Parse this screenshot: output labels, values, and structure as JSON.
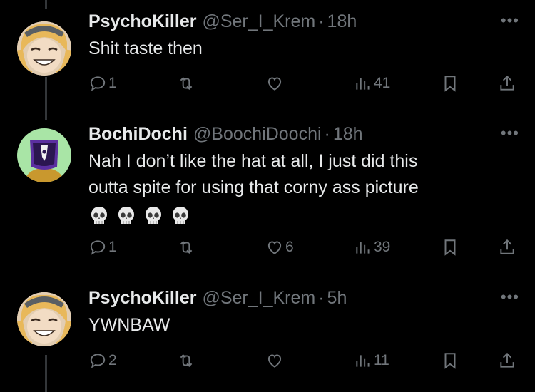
{
  "tweets": [
    {
      "name": "PsychoKiller",
      "handle": "@Ser_I_Krem",
      "time": "18h",
      "text_lines": [
        "Shit taste then"
      ],
      "has_emojis": false,
      "replies": "1",
      "retweets": "",
      "likes": "",
      "views": "41"
    },
    {
      "name": "BochiDochi",
      "handle": "@BoochiDoochi",
      "time": "18h",
      "text_lines": [
        "Nah I don’t like the hat at all, I just did this",
        "outta spite for using that corny ass picture"
      ],
      "has_emojis": true,
      "emoji_count": 4,
      "replies": "1",
      "retweets": "",
      "likes": "6",
      "views": "39"
    },
    {
      "name": "PsychoKiller",
      "handle": "@Ser_I_Krem",
      "time": "5h",
      "text_lines": [
        "YWNBAW"
      ],
      "has_emojis": false,
      "replies": "2",
      "retweets": "",
      "likes": "",
      "views": "11"
    }
  ],
  "more_label": "•••",
  "dot_separator": "·",
  "colors": {
    "background": "#000000",
    "text": "#e7e9ea",
    "muted": "#71767b",
    "thread_line": "#333639"
  },
  "icons": [
    "reply-icon",
    "retweet-icon",
    "like-icon",
    "views-icon",
    "bookmark-icon",
    "share-icon",
    "more-icon",
    "skull-emoji"
  ]
}
